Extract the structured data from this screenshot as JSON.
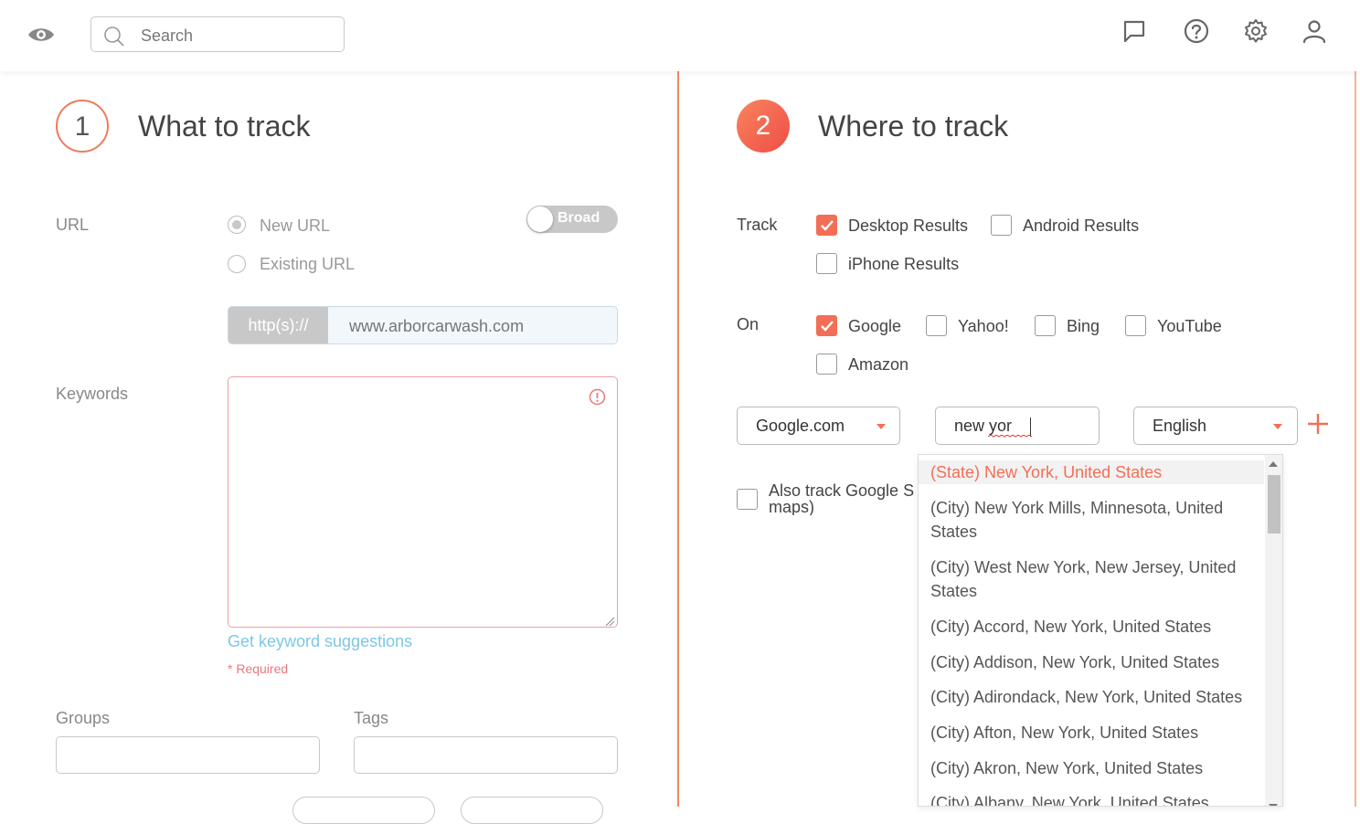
{
  "topbar": {
    "search_placeholder": "Search",
    "icons": [
      "eye-icon",
      "search-icon",
      "chat-icon",
      "help-icon",
      "gear-icon",
      "user-icon"
    ]
  },
  "step1": {
    "number": "1",
    "title": "What to track",
    "url_label": "URL",
    "radio_new_url": "New URL",
    "radio_existing_url": "Existing URL",
    "selected_radio": "New URL",
    "toggle_label": "Broad",
    "url_prefix": "http(s)://",
    "url_placeholder": "www.arborcarwash.com",
    "keywords_label": "Keywords",
    "keywords_value": "",
    "suggest_link": "Get keyword suggestions",
    "required_note": "* Required",
    "groups_label": "Groups",
    "tags_label": "Tags"
  },
  "step2": {
    "number": "2",
    "title": "Where to track",
    "track_label": "Track",
    "track_options": [
      {
        "label": "Desktop Results",
        "checked": true
      },
      {
        "label": "Android Results",
        "checked": false
      },
      {
        "label": "iPhone Results",
        "checked": false
      }
    ],
    "on_label": "On",
    "engine_options": [
      {
        "label": "Google",
        "checked": true
      },
      {
        "label": "Yahoo!",
        "checked": false
      },
      {
        "label": "Bing",
        "checked": false
      },
      {
        "label": "YouTube",
        "checked": false
      },
      {
        "label": "Amazon",
        "checked": false
      }
    ],
    "engine_select": "Google.com",
    "location_input": "new yor",
    "language_select": "English",
    "snap_pack_label_line1": "Also track Google Sn",
    "snap_pack_label_line2": "maps)",
    "location_suggestions": [
      "(State) New York, United States",
      "(City) New York Mills, Minnesota, United States",
      "(City) West New York, New Jersey, United States",
      "(City) Accord, New York, United States",
      "(City) Addison, New York, United States",
      "(City) Adirondack, New York, United States",
      "(City) Afton, New York, United States",
      "(City) Akron, New York, United States",
      "(City) Albany, New York, United States"
    ]
  },
  "colors": {
    "accent": "#f36e56",
    "divider": "#f28a5c",
    "link": "#7cc7e8",
    "error": "#e8787a"
  }
}
